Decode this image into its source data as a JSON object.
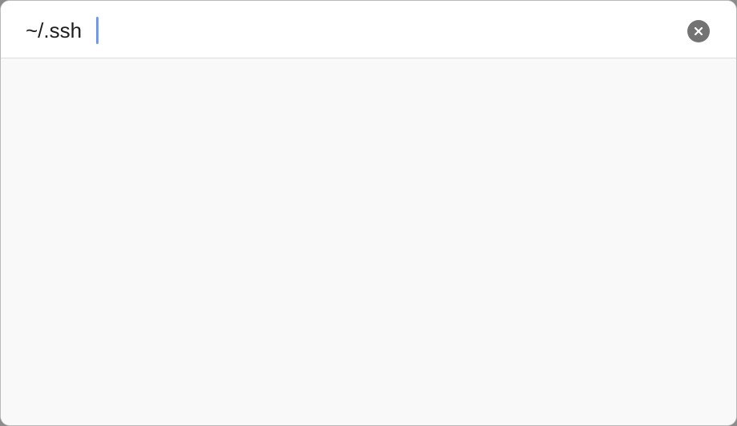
{
  "search": {
    "value": "~/.ssh",
    "clear_button": {
      "icon": "close-icon",
      "color": "#737373"
    }
  },
  "colors": {
    "caret": "#6b9af0",
    "panel_background": "#f9f9f9",
    "search_background": "#ffffff"
  }
}
